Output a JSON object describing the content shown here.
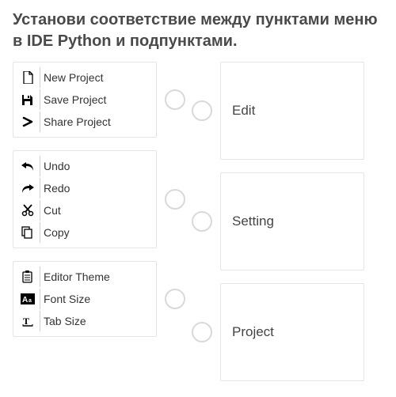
{
  "question": "Установи соответствие между пунктами меню в IDE Python и подпунктами.",
  "left_cards": [
    {
      "items": [
        {
          "icon": "file-icon",
          "label": "New Project"
        },
        {
          "icon": "save-icon",
          "label": "Save Project"
        },
        {
          "icon": "share-icon",
          "label": "Share Project"
        }
      ]
    },
    {
      "items": [
        {
          "icon": "undo-icon",
          "label": "Undo"
        },
        {
          "icon": "redo-icon",
          "label": "Redo"
        },
        {
          "icon": "cut-icon",
          "label": "Cut"
        },
        {
          "icon": "copy-icon",
          "label": "Copy"
        }
      ]
    },
    {
      "items": [
        {
          "icon": "clipboard-icon",
          "label": "Editor Theme"
        },
        {
          "icon": "fontsize-icon",
          "label": "Font Size"
        },
        {
          "icon": "tabsize-icon",
          "label": "Tab Size"
        }
      ]
    }
  ],
  "right_cards": [
    {
      "label": "Edit"
    },
    {
      "label": "Setting"
    },
    {
      "label": "Project"
    }
  ]
}
